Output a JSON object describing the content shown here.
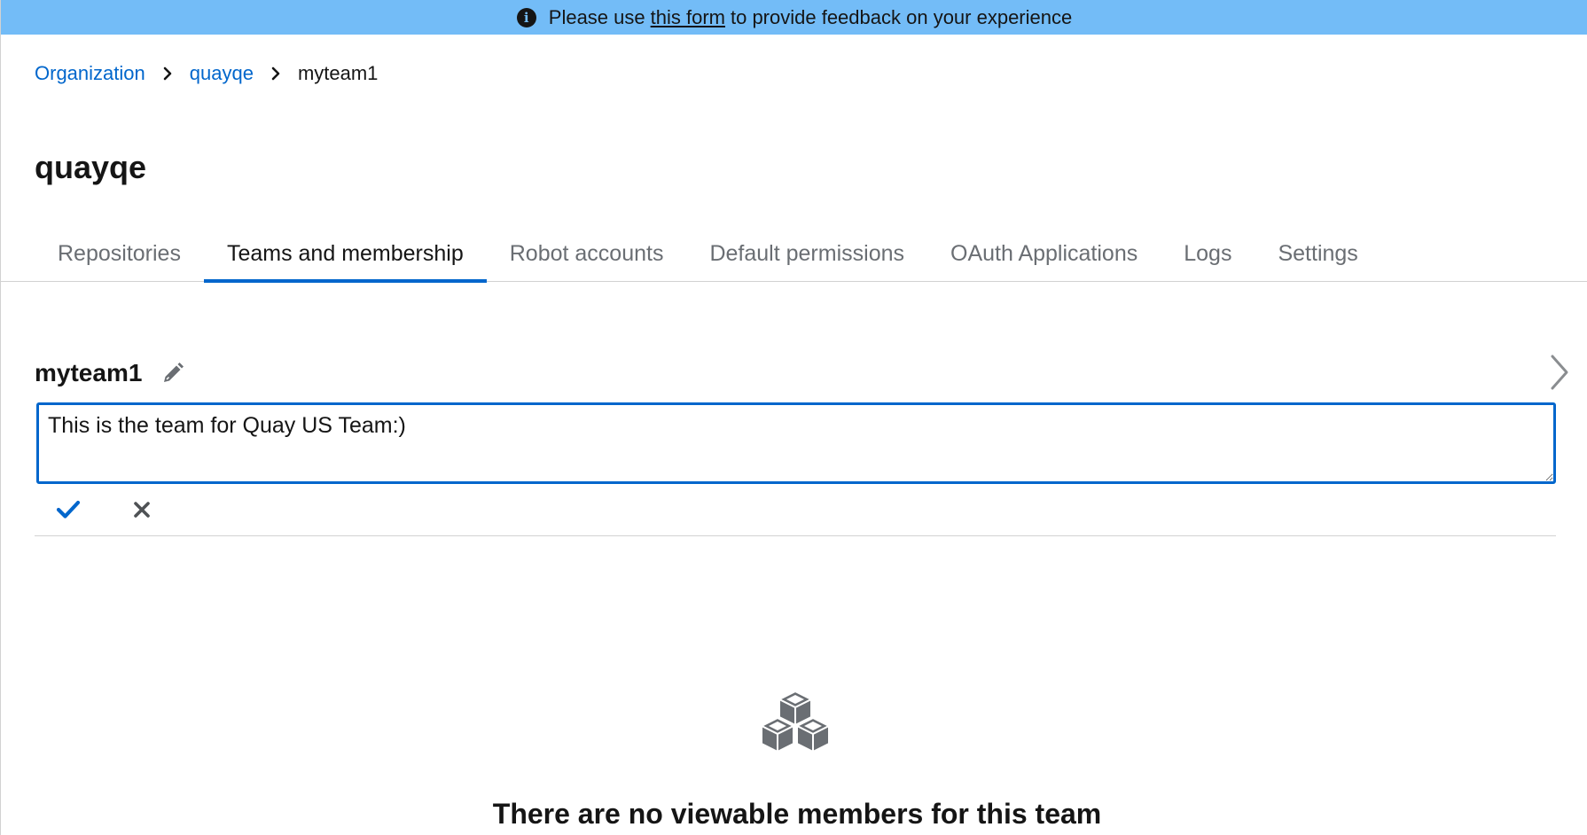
{
  "banner": {
    "prefix": "Please use",
    "link_text": "this form",
    "suffix": "to provide feedback on your experience",
    "background": "#73bcf7"
  },
  "breadcrumb": {
    "items": [
      "Organization",
      "quayqe",
      "myteam1"
    ]
  },
  "page_title": "quayqe",
  "tabs": [
    {
      "label": "Repositories",
      "active": false
    },
    {
      "label": "Teams and membership",
      "active": true
    },
    {
      "label": "Robot accounts",
      "active": false
    },
    {
      "label": "Default permissions",
      "active": false
    },
    {
      "label": "OAuth Applications",
      "active": false
    },
    {
      "label": "Logs",
      "active": false
    },
    {
      "label": "Settings",
      "active": false
    }
  ],
  "team": {
    "name": "myteam1",
    "description_value": "This is the team for Quay US Team:)"
  },
  "empty_state": {
    "title": "There are no viewable members for this team",
    "icon": "cubes-icon"
  },
  "colors": {
    "accent": "#0066cc",
    "text": "#151515",
    "muted": "#6a6e73",
    "border": "#d2d2d2"
  }
}
